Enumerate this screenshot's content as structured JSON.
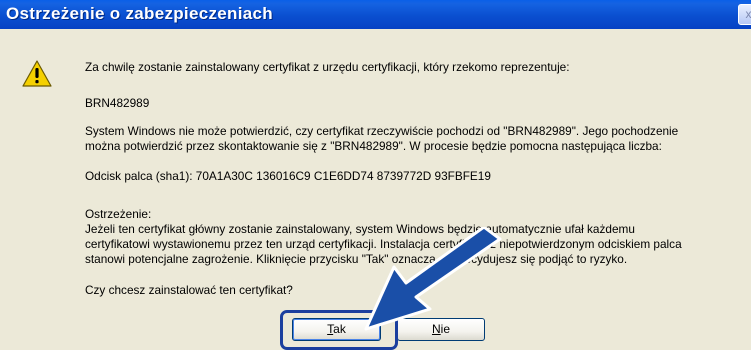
{
  "window": {
    "title": "Ostrzeżenie o zabezpieczeniach",
    "close_glyph": "x"
  },
  "message": {
    "line1": "Za chwilę zostanie zainstalowany certyfikat z urzędu certyfikacji, który rzekomo reprezentuje:",
    "issuer": "BRN482989",
    "verify_line1": "System Windows nie może potwierdzić, czy certyfikat rzeczywiście pochodzi od \"BRN482989\". Jego pochodzenie",
    "verify_line2": "można potwierdzić przez skontaktowanie się z \"BRN482989\". W procesie będzie pomocna następująca liczba:",
    "thumbprint": "Odcisk palca (sha1): 70A1A30C 136016C9 C1E6DD74 8739772D 93FBFE19",
    "warning_heading": "Ostrzeżenie:",
    "warning_line1": "Jeżeli ten certyfikat główny zostanie zainstalowany, system Windows będzie automatycznie ufał każdemu",
    "warning_line2": "certyfikatowi wystawionemu przez ten urząd certyfikacji. Instalacja certyfikatu z niepotwierdzonym odciskiem palca",
    "warning_line3": "stanowi potencjalne zagrożenie. Kliknięcie przycisku \"Tak\" oznacza, że decydujesz się podjąć to ryzyko.",
    "question": "Czy chcesz zainstalować ten certyfikat?"
  },
  "buttons": {
    "yes_mnemonic": "T",
    "yes_rest": "ak",
    "no_mnemonic": "N",
    "no_rest": "ie"
  },
  "colors": {
    "titlebar": "#0a4fd0",
    "dialog_bg": "#ece9d8",
    "callout_arrow": "#1a4fa8"
  }
}
